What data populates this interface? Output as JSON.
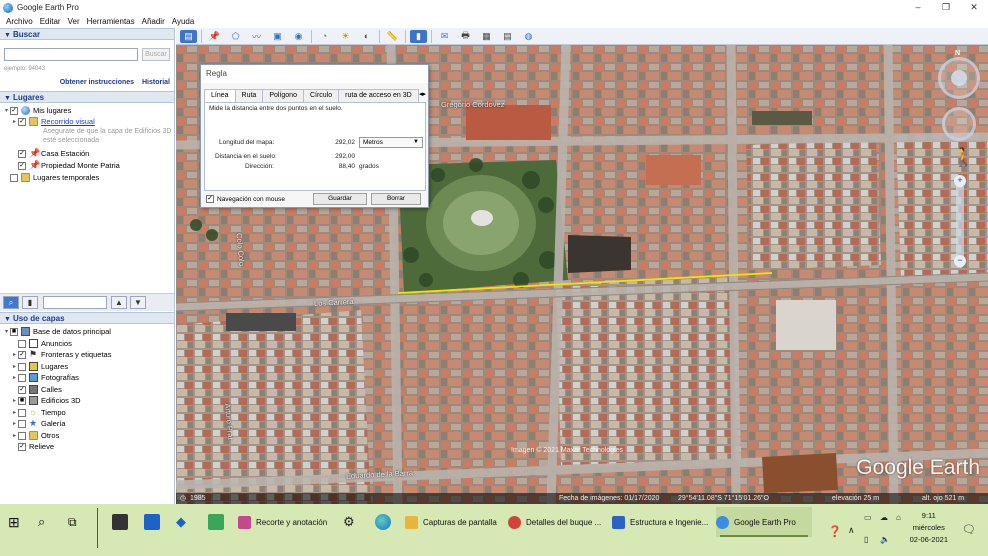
{
  "window": {
    "title": "Google Earth Pro",
    "buttons": [
      "–",
      "❐",
      "✕"
    ]
  },
  "menu": [
    "Archivo",
    "Editar",
    "Ver",
    "Herramientas",
    "Añadir",
    "Ayuda"
  ],
  "search": {
    "header": "Buscar",
    "placeholder": "",
    "button": "Buscar",
    "example": "ejemplo: 94043",
    "link_directions": "Obtener instrucciones",
    "link_history": "Historial"
  },
  "places": {
    "header": "Lugares",
    "items": [
      {
        "label": "Mis lugares",
        "checked": true
      },
      {
        "label": "Recorrido visual",
        "checked": true
      },
      {
        "label": "Asegurate de que la capa de Edificios 3D esté seleccionada"
      },
      {
        "label": "Casa Estación",
        "checked": true
      },
      {
        "label": "Propiedad Monte Patria",
        "checked": true
      },
      {
        "label": "Lugares temporales",
        "checked": false
      }
    ]
  },
  "layers": {
    "header": "Uso de capas",
    "items": [
      {
        "label": "Base de datos principal",
        "checked": true
      },
      {
        "label": "Anuncios",
        "checked": false
      },
      {
        "label": "Fronteras y etiquetas",
        "checked": true
      },
      {
        "label": "Lugares",
        "checked": false
      },
      {
        "label": "Fotografías",
        "checked": false
      },
      {
        "label": "Calles",
        "checked": true
      },
      {
        "label": "Edificios 3D",
        "checked": false
      },
      {
        "label": "Tiempo",
        "checked": false
      },
      {
        "label": "Galería",
        "checked": false
      },
      {
        "label": "Otros",
        "checked": false
      },
      {
        "label": "Relieve",
        "checked": true
      }
    ]
  },
  "ruler": {
    "title": "Regla",
    "tabs": [
      "Línea",
      "Ruta",
      "Polígono",
      "Círculo",
      "ruta de acceso en 3D"
    ],
    "description": "Mide la distancia entre dos puntos en el suelo.",
    "map_length_label": "Longitud del mapa:",
    "map_length_value": "292,02",
    "unit": "Metros",
    "ground_length_label": "Distancia en el suelo:",
    "ground_length_value": "292,00",
    "heading_label": "Dirección:",
    "heading_value": "88,40",
    "heading_unit": "grados",
    "mouse_nav_label": "Navegación con mouse",
    "save_button": "Guardar",
    "clear_button": "Borrar"
  },
  "map": {
    "streets": [
      "Gregorio Cordovez",
      "Eduardo de la Barra",
      "Colo Colo",
      "Arturo Prat",
      "Los Carrera"
    ],
    "copyright": "Imagen © 2021 Maxar Technologies",
    "logo": "Google Earth",
    "status": {
      "year": "1985",
      "imagery_date": "Fecha de imágenes: 01/17/2020",
      "coords": "29°54'11.08\"S  71°15'01.26\"O",
      "elevation": "elevación  25 m",
      "eye_alt": "alt. ojo  521 m"
    },
    "measure_line_color": "#f2e400"
  },
  "taskbar": {
    "apps": [
      {
        "label": "Recorte y anotación",
        "color": "#c4498a"
      },
      {
        "label": "Capturas de pantalla",
        "color": "#e8b53b"
      },
      {
        "label": "Detalles del buque ...",
        "color": "#d2443a"
      },
      {
        "label": "Estructura e Ingenie...",
        "color": "#2b62c6"
      },
      {
        "label": "Google Earth Pro",
        "color": "#3a8de0"
      }
    ],
    "time": "9:11",
    "day": "miércoles",
    "date": "02-06-2021"
  }
}
